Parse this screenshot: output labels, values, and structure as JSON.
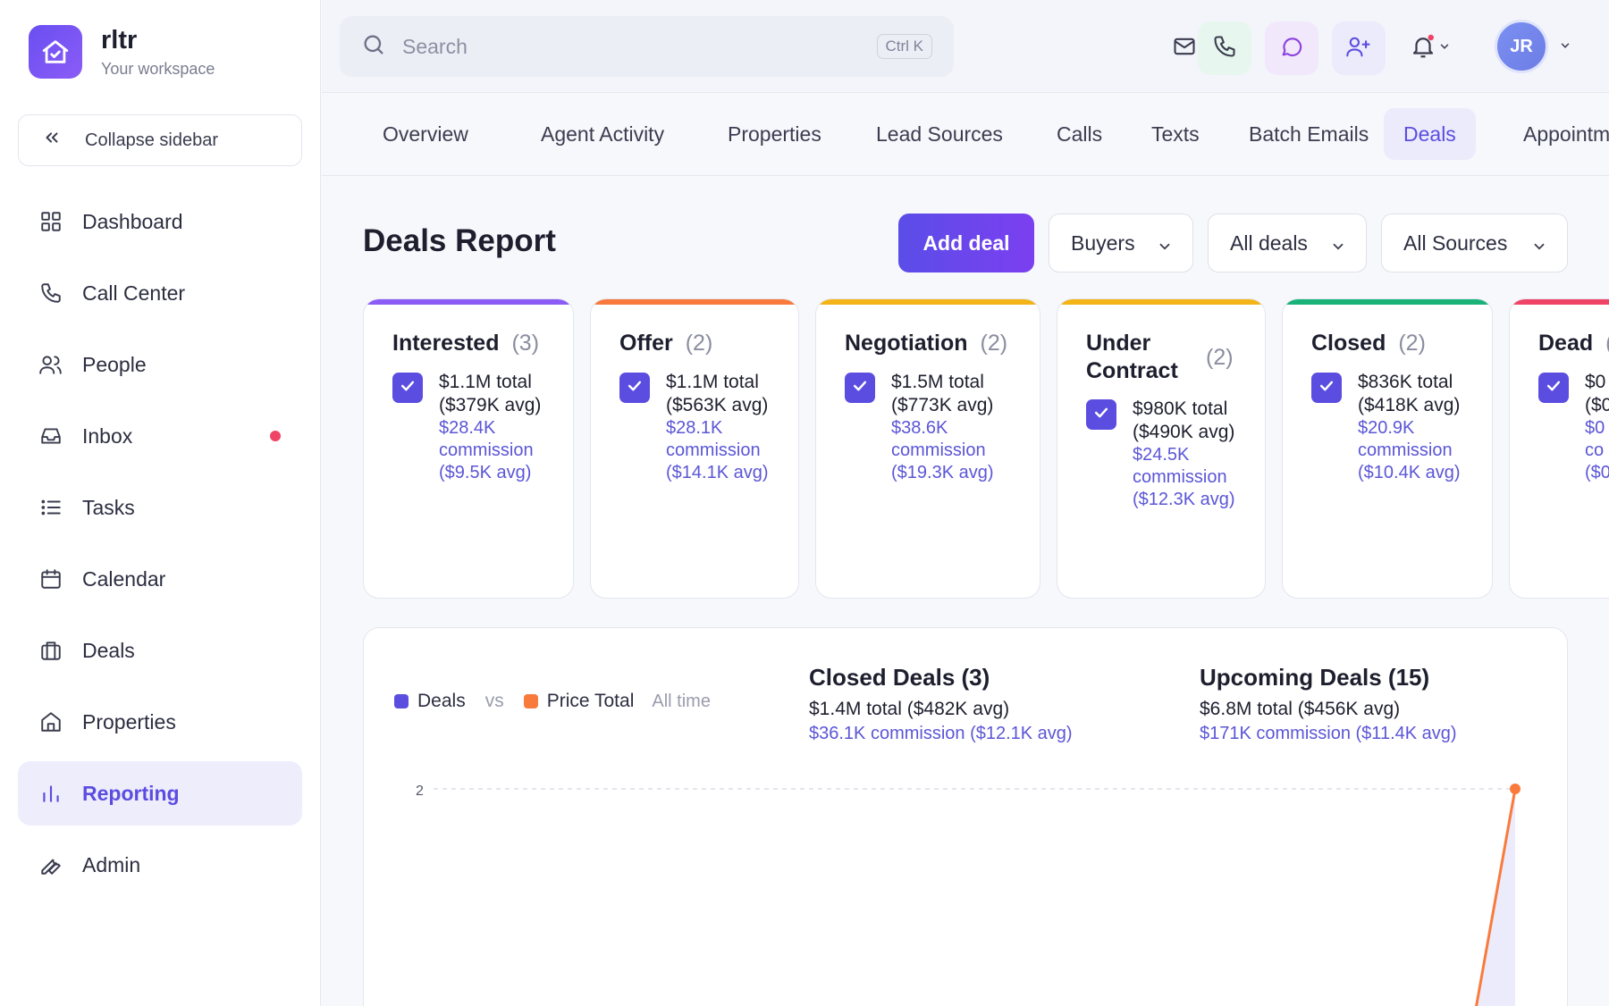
{
  "brand": {
    "name": "rltr",
    "subtitle": "Your workspace",
    "logo_icon": "home-icon"
  },
  "sidebar": {
    "collapse_label": "Collapse sidebar",
    "items": [
      {
        "label": "Dashboard",
        "icon": "grid-icon",
        "active": false
      },
      {
        "label": "Call Center",
        "icon": "phone-icon",
        "active": false
      },
      {
        "label": "People",
        "icon": "users-icon",
        "active": false
      },
      {
        "label": "Inbox",
        "icon": "inbox-icon",
        "active": false,
        "badge_dot": true
      },
      {
        "label": "Tasks",
        "icon": "list-icon",
        "active": false
      },
      {
        "label": "Calendar",
        "icon": "calendar-icon",
        "active": false
      },
      {
        "label": "Deals",
        "icon": "briefcase-icon",
        "active": false
      },
      {
        "label": "Properties",
        "icon": "house-icon",
        "active": false
      },
      {
        "label": "Reporting",
        "icon": "bar-chart-icon",
        "active": true
      },
      {
        "label": "Admin",
        "icon": "wrench-icon",
        "active": false
      }
    ]
  },
  "topbar": {
    "search_placeholder": "Search",
    "search_shortcut": "Ctrl K",
    "avatar_initials": "JR",
    "colors": {
      "accent": "#5b4de0",
      "notification": "#ef4466"
    }
  },
  "tabs": [
    {
      "label": "Overview",
      "active": false
    },
    {
      "label": "Agent Activity",
      "active": false
    },
    {
      "label": "Properties",
      "active": false
    },
    {
      "label": "Lead Sources",
      "active": false
    },
    {
      "label": "Calls",
      "active": false
    },
    {
      "label": "Texts",
      "active": false
    },
    {
      "label": "Batch Emails",
      "active": false
    },
    {
      "label": "Deals",
      "active": true
    },
    {
      "label": "Appointme",
      "active": false
    }
  ],
  "header": {
    "title": "Deals Report",
    "add_button": "Add deal",
    "filters": [
      "Buyers",
      "All deals",
      "All Sources"
    ]
  },
  "stages": [
    {
      "name": "Interested",
      "count": "(3)",
      "color": "#8b5cf6",
      "total": "$1.1M total ($379K avg)",
      "commission": "$28.4K commission ($9.5K avg)"
    },
    {
      "name": "Offer",
      "count": "(2)",
      "color": "#f97a3d",
      "total": "$1.1M total ($563K avg)",
      "commission": "$28.1K commission ($14.1K avg)"
    },
    {
      "name": "Negotiation",
      "count": "(2)",
      "color": "#f2b416",
      "total": "$1.5M total ($773K avg)",
      "commission": "$38.6K commission ($19.3K avg)"
    },
    {
      "name": "Under Contract",
      "count": "(2)",
      "color": "#f2b416",
      "total": "$980K total ($490K avg)",
      "commission": "$24.5K commission ($12.3K avg)"
    },
    {
      "name": "Closed",
      "count": "(2)",
      "color": "#19b37a",
      "total": "$836K total ($418K avg)",
      "commission": "$20.9K commission ($10.4K avg)"
    },
    {
      "name": "Dead",
      "count": "(",
      "color": "#ef4466",
      "total": "$0 ($0",
      "commission": "$0 co ($0"
    }
  ],
  "chart_panel": {
    "legend": {
      "deals": "Deals",
      "vs": "vs",
      "price": "Price Total",
      "range": "All time",
      "deals_color": "#5b4de0",
      "price_color": "#f97a3d"
    },
    "closed": {
      "title": "Closed Deals (3)",
      "total": "$1.4M total ($482K avg)",
      "commission": "$36.1K commission ($12.1K avg)"
    },
    "upcoming": {
      "title": "Upcoming Deals (15)",
      "total": "$6.8M total ($456K avg)",
      "commission": "$171K commission ($11.4K avg)"
    }
  },
  "chart_data": {
    "type": "line",
    "y_ticks": [
      "2"
    ],
    "series": [
      {
        "name": "Price Total",
        "color": "#f97a3d"
      }
    ]
  }
}
